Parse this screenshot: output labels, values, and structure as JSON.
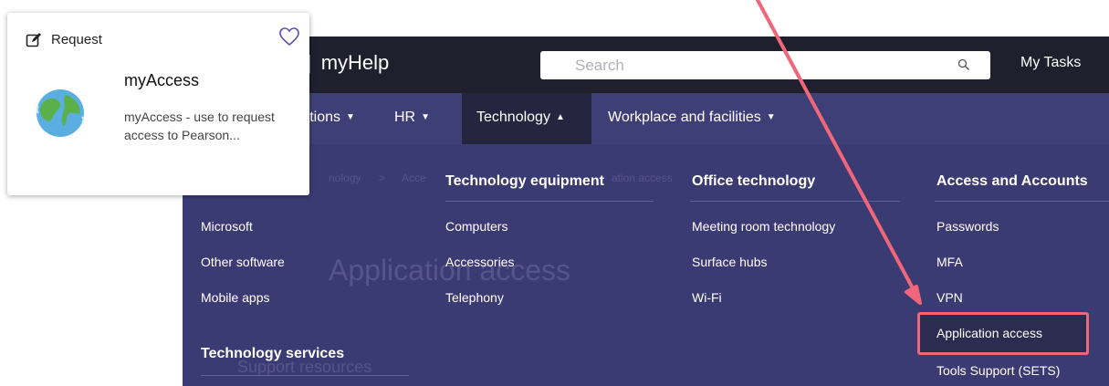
{
  "header": {
    "app_name": "myHelp",
    "search_placeholder": "Search",
    "my_tasks": "My Tasks"
  },
  "nav": {
    "items": [
      {
        "label": "rations"
      },
      {
        "label": "HR"
      },
      {
        "label": "Technology",
        "active": true
      },
      {
        "label": "Workplace and facilities"
      }
    ]
  },
  "background": {
    "breadcrumb_1": "nology",
    "breadcrumb_sep": ">",
    "breadcrumb_2": "Acce",
    "breadcrumb_3": "ation access",
    "page_title": "Application access",
    "subheading": "Support resources"
  },
  "menu": {
    "col1": {
      "links": [
        "Microsoft",
        "Other software",
        "Mobile apps"
      ],
      "heading2": "Technology services"
    },
    "col2": {
      "heading": "Technology equipment",
      "links": [
        "Computers",
        "Accessories",
        "Telephony"
      ]
    },
    "col3": {
      "heading": "Office technology",
      "links": [
        "Meeting room technology",
        "Surface hubs",
        "Wi-Fi"
      ]
    },
    "col4": {
      "heading": "Access and Accounts",
      "links": [
        "Passwords",
        "MFA",
        "VPN",
        "Application access",
        "Tools Support (SETS)"
      ]
    }
  },
  "card": {
    "type_label": "Request",
    "title": "myAccess",
    "description": "myAccess - use to request access to Pearson..."
  },
  "colors": {
    "menu_bg": "#3b3b73",
    "topbar_bg": "#1f1f2e",
    "highlight": "#f0677b"
  }
}
